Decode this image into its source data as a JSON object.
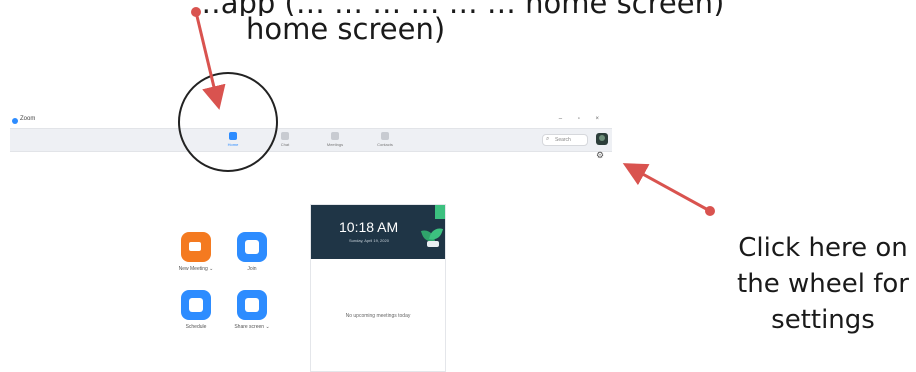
{
  "captions": {
    "top_line": "…app (… … … … … … home screen)",
    "home_screen": "home screen)",
    "instruction_line1": "Click here on",
    "instruction_line2": "the wheel for",
    "instruction_line3": "settings"
  },
  "window": {
    "title": "Zoom",
    "controls": "– ▫ ×"
  },
  "toolbar": {
    "tabs": [
      {
        "label": "Home",
        "icon": "home-icon"
      },
      {
        "label": "Chat",
        "icon": "chat-icon"
      },
      {
        "label": "Meetings",
        "icon": "clock-icon"
      },
      {
        "label": "Contacts",
        "icon": "contacts-icon"
      }
    ],
    "search_placeholder": "Search",
    "settings_icon": "gear-icon"
  },
  "actions": [
    {
      "label": "New Meeting ⌄",
      "icon": "video-camera-icon",
      "color": "#f47a20"
    },
    {
      "label": "Join",
      "icon": "plus-icon",
      "color": "#2d8cff"
    },
    {
      "label": "Schedule",
      "icon": "calendar-icon",
      "color": "#2d8cff"
    },
    {
      "label": "Share screen ⌄",
      "icon": "share-screen-icon",
      "color": "#2d8cff"
    }
  ],
  "panel": {
    "time": "10:18 AM",
    "date": "Sunday, April 19, 2020",
    "empty_message": "No upcoming meetings today"
  },
  "colors": {
    "arrow": "#d9534f",
    "header": "#1f3546",
    "accent": "#2d8cff",
    "orange": "#f47a20"
  }
}
